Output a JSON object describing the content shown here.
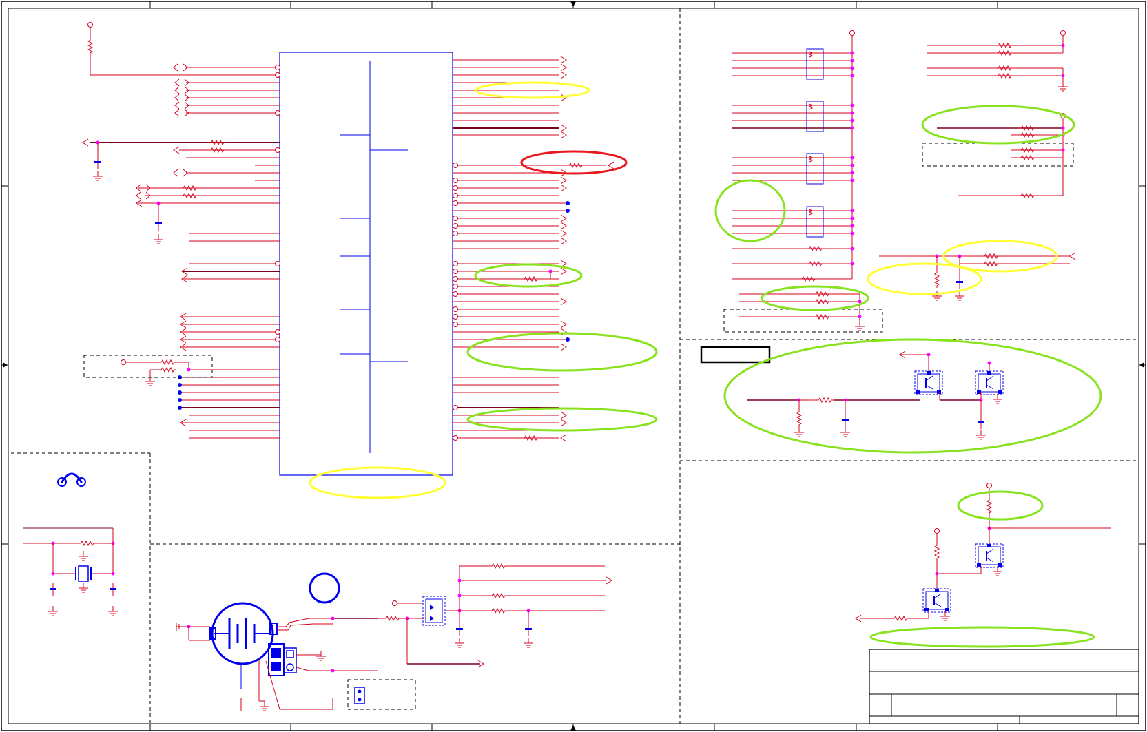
{
  "title_block": {
    "title": "",
    "document_number": "",
    "revision": "",
    "sheet": "",
    "date": ""
  },
  "border": {
    "top_arrow": "top-center-arrow",
    "bottom_arrow": "bottom-center-arrow",
    "left_arrow": "left-center-arrow",
    "right_arrow": "right-center-arrow"
  },
  "highlight_colors": {
    "yellow": "#ffff33",
    "green": "#88e21e",
    "red": "#e8181e"
  },
  "wire_colors": {
    "net": "#d8001c",
    "bus": "#7a0020",
    "component": "#0000ee",
    "junction": "#ff00ff"
  },
  "icons": {
    "power_port": "power-port-icon",
    "ground": "ground-icon",
    "resistor": "resistor-icon",
    "capacitor": "capacitor-icon",
    "transistor": "transistor-icon",
    "battery": "battery-icon",
    "crystal": "crystal-icon",
    "headphone": "headphone-icon",
    "connector": "connector-icon",
    "jumper": "jumper-icon",
    "net_arrow": "net-arrow-icon"
  }
}
